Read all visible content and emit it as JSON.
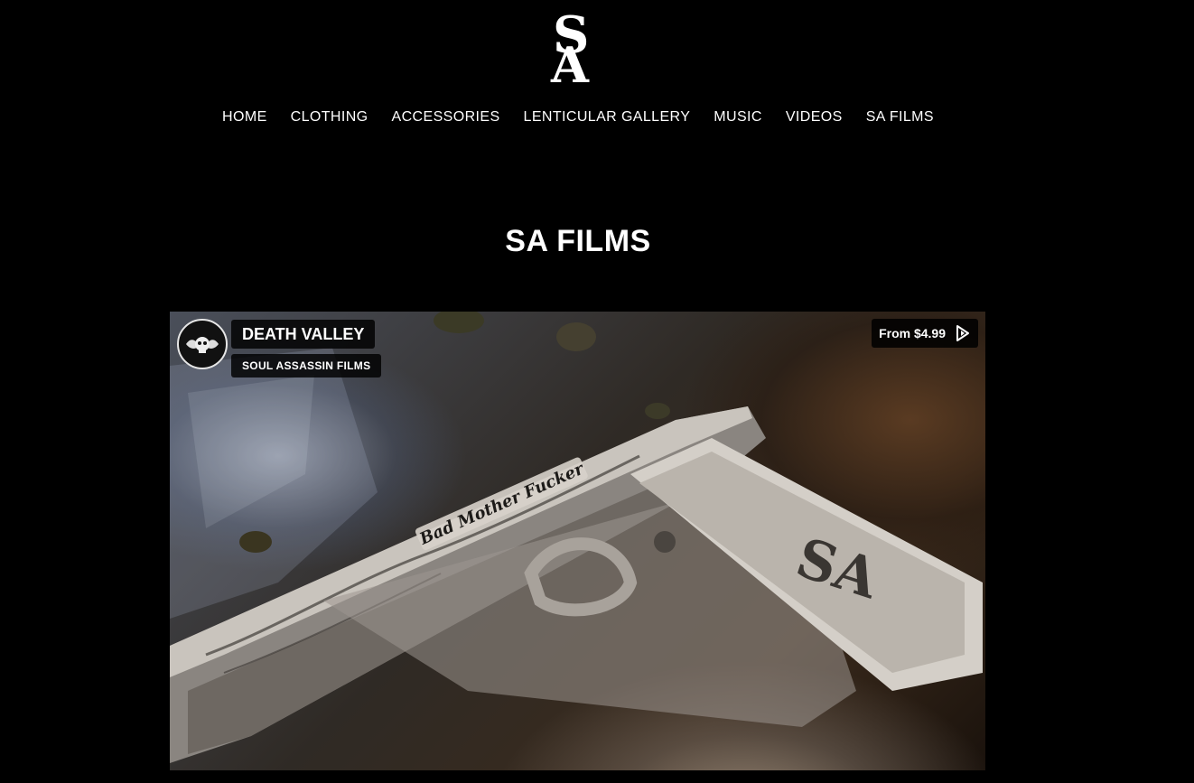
{
  "brand": {
    "logo_top": "S",
    "logo_bottom": "A"
  },
  "nav": {
    "items": [
      {
        "label": "HOME"
      },
      {
        "label": "CLOTHING"
      },
      {
        "label": "ACCESSORIES"
      },
      {
        "label": "LENTICULAR GALLERY"
      },
      {
        "label": "MUSIC"
      },
      {
        "label": "VIDEOS"
      },
      {
        "label": "SA FILMS"
      }
    ]
  },
  "page": {
    "title": "SA FILMS"
  },
  "video": {
    "title": "DEATH VALLEY",
    "channel": "SOUL ASSASSIN FILMS",
    "price": "From $4.99",
    "price_icon": "play-icon",
    "engraving": "Bad Mother Fucker",
    "channel_logo_icon": "skull-wings-icon"
  }
}
